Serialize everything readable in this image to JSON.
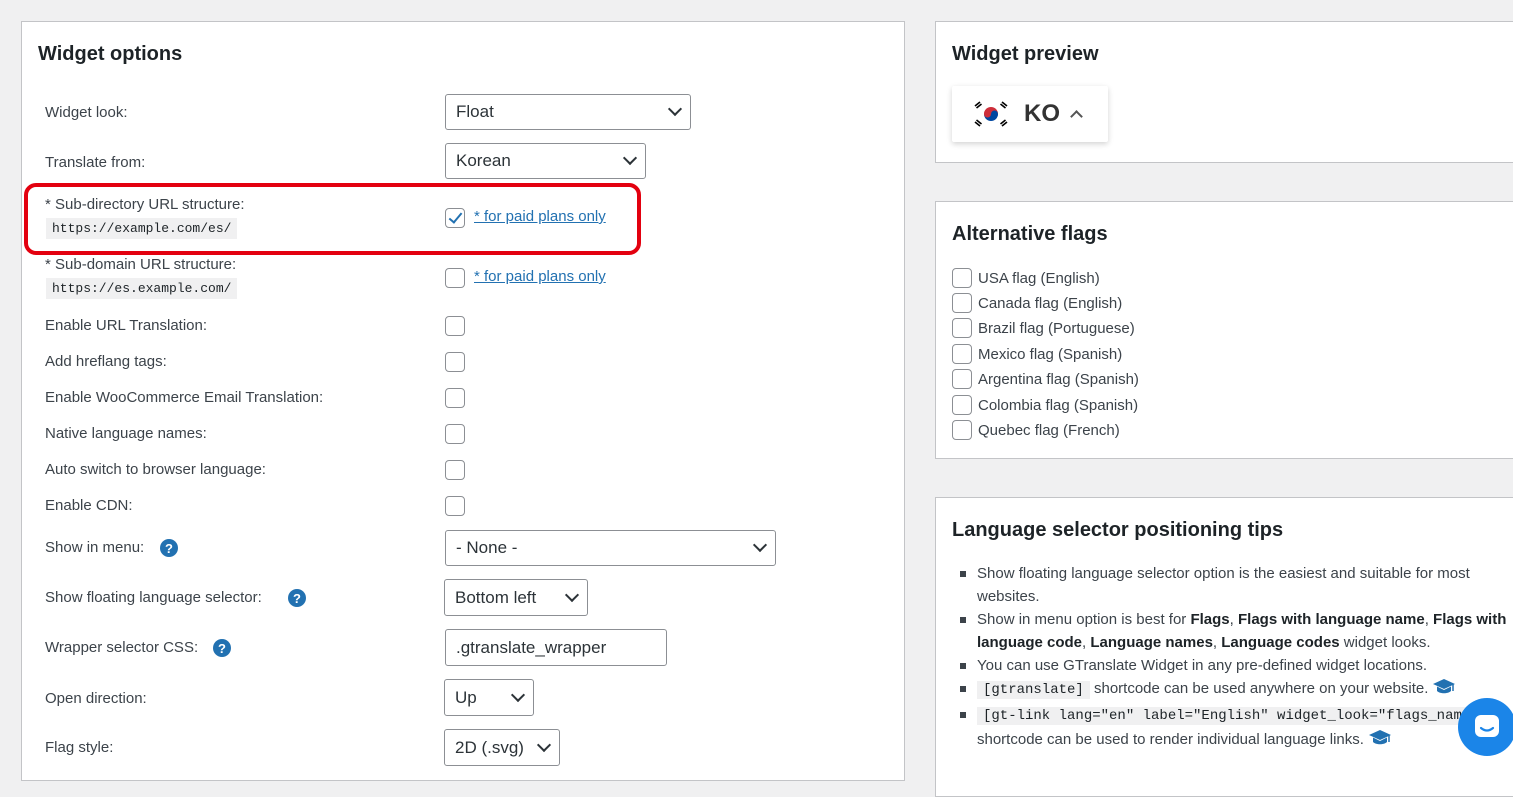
{
  "options": {
    "title": "Widget options",
    "widget_look": {
      "label": "Widget look:",
      "value": "Float"
    },
    "translate_from": {
      "label": "Translate from:",
      "value": "Korean"
    },
    "subdirectory": {
      "label": "* Sub-directory URL structure:",
      "example": "https://example.com/es/",
      "checked": true,
      "link": "* for paid plans only"
    },
    "subdomain": {
      "label": "* Sub-domain URL structure:",
      "example": "https://es.example.com/",
      "checked": false,
      "link": "* for paid plans only"
    },
    "url_translation": {
      "label": "Enable URL Translation:"
    },
    "hreflang": {
      "label": "Add hreflang tags:"
    },
    "woo_email": {
      "label": "Enable WooCommerce Email Translation:"
    },
    "native_names": {
      "label": "Native language names:"
    },
    "auto_switch": {
      "label": "Auto switch to browser language:"
    },
    "cdn": {
      "label": "Enable CDN:"
    },
    "show_in_menu": {
      "label": "Show in menu:",
      "value": "- None -"
    },
    "floating_selector": {
      "label": "Show floating language selector:",
      "value": "Bottom left"
    },
    "wrapper_css": {
      "label": "Wrapper selector CSS:",
      "value": ".gtranslate_wrapper"
    },
    "open_direction": {
      "label": "Open direction:",
      "value": "Up"
    },
    "flag_style": {
      "label": "Flag style:",
      "value": "2D (.svg)"
    },
    "help_glyph": "?"
  },
  "preview": {
    "title": "Widget preview",
    "lang_code": "KO"
  },
  "altflags": {
    "title": "Alternative flags",
    "items": [
      "USA flag (English)",
      "Canada flag (English)",
      "Brazil flag (Portuguese)",
      "Mexico flag (Spanish)",
      "Argentina flag (Spanish)",
      "Colombia flag (Spanish)",
      "Quebec flag (French)"
    ]
  },
  "tips": {
    "title": "Language selector positioning tips",
    "t1": "Show floating language selector option is the easiest and suitable for most websites.",
    "t2_pre": "Show in menu option is best for ",
    "t2_b1": "Flags",
    "t2_s1": ", ",
    "t2_b2": "Flags with language name",
    "t2_s2": ", ",
    "t2_b3": "Flags with language code",
    "t2_s3": ", ",
    "t2_b4": "Language names",
    "t2_s4": ", ",
    "t2_b5": "Language codes",
    "t2_post": " widget looks.",
    "t3": "You can use GTranslate Widget in any pre-defined widget locations.",
    "t4_code": "[gtranslate]",
    "t4_text": " shortcode can be used anywhere on your website.",
    "t5_code": "[gt-link lang=\"en\" label=\"English\" widget_look=\"flags_name\"]",
    "t5_text": " shortcode can be used to render individual language links."
  },
  "colors": {
    "accent": "#2271b1",
    "highlight": "#e3000f",
    "chat": "#1b85e8"
  }
}
